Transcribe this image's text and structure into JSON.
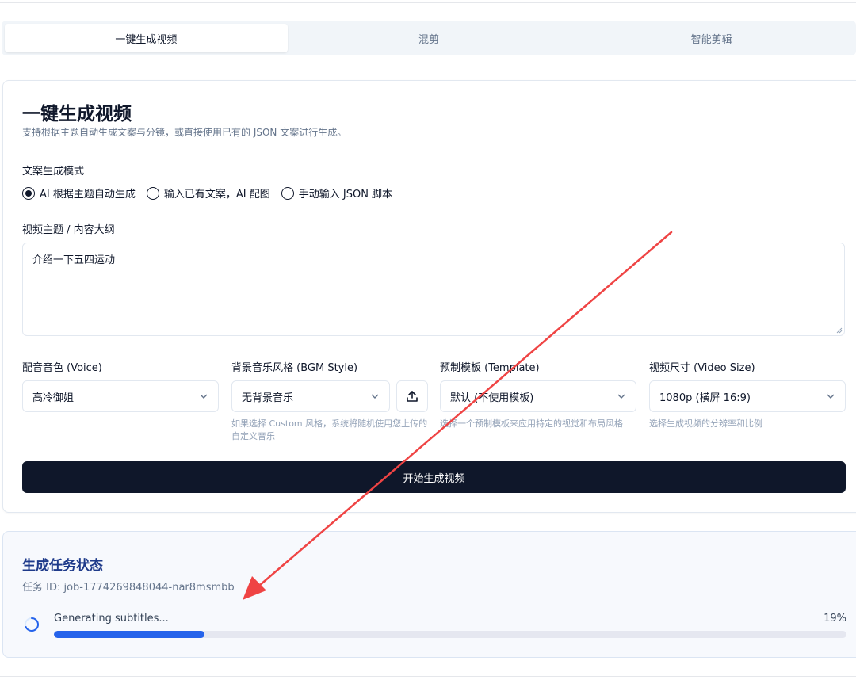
{
  "tabs": [
    {
      "label": "一键生成视频",
      "active": true
    },
    {
      "label": "混剪",
      "active": false
    },
    {
      "label": "智能剪辑",
      "active": false
    }
  ],
  "card": {
    "title": "一键生成视频",
    "subtitle": "支持根据主题自动生成文案与分镜，或直接使用已有的 JSON 文案进行生成。"
  },
  "mode": {
    "label": "文案生成模式",
    "options": [
      {
        "label": "AI 根据主题自动生成",
        "selected": true
      },
      {
        "label": "输入已有文案，AI 配图",
        "selected": false
      },
      {
        "label": "手动输入 JSON 脚本",
        "selected": false
      }
    ]
  },
  "topic": {
    "label": "视频主题 / 内容大纲",
    "value": "介绍一下五四运动"
  },
  "voice": {
    "label": "配音音色 (Voice)",
    "value": "高冷御姐"
  },
  "bgm": {
    "label": "背景音乐风格 (BGM Style)",
    "value": "无背景音乐",
    "hint": "如果选择 Custom 风格，系统将随机使用您上传的自定义音乐"
  },
  "template": {
    "label": "预制模板 (Template)",
    "value": "默认 (不使用模板)",
    "hint": "选择一个预制模板来应用特定的视觉和布局风格"
  },
  "size": {
    "label": "视频尺寸 (Video Size)",
    "value": "1080p (横屏 16:9)",
    "hint": "选择生成视频的分辨率和比例"
  },
  "actions": {
    "generate_label": "开始生成视频"
  },
  "status": {
    "title": "生成任务状态",
    "job_id": "任务 ID: job-1774269848044-nar8msmbb",
    "text": "Generating subtitles...",
    "percent_label": "19%",
    "progress": 0.19
  },
  "colors": {
    "primary": "#0f172a",
    "progress": "#2563eb",
    "status_title": "#1e3a8a",
    "annotation_arrow": "#ef4444"
  }
}
